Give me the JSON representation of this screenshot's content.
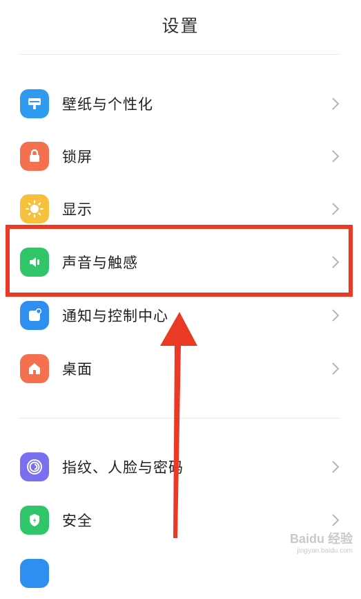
{
  "header": {
    "title": "设置"
  },
  "sections": [
    {
      "items": [
        {
          "label": "壁纸与个性化",
          "icon": "wallpaper-icon",
          "color": "#2e9bf0"
        },
        {
          "label": "锁屏",
          "icon": "lock-icon",
          "color": "#f4704e"
        },
        {
          "label": "显示",
          "icon": "brightness-icon",
          "color": "#f7c03c"
        },
        {
          "label": "声音与触感",
          "icon": "speaker-icon",
          "color": "#31c56a"
        },
        {
          "label": "通知与控制中心",
          "icon": "notification-icon",
          "color": "#2e8ff0"
        },
        {
          "label": "桌面",
          "icon": "home-icon",
          "color": "#f4704e"
        }
      ]
    },
    {
      "items": [
        {
          "label": "指纹、人脸与密码",
          "icon": "fingerprint-icon",
          "color": "#7a6ff0"
        },
        {
          "label": "安全",
          "icon": "shield-icon",
          "color": "#31c56a"
        }
      ]
    }
  ],
  "annotation": {
    "highlight_color": "#ea3a25",
    "arrow_color": "#ea3a25"
  },
  "watermark": {
    "text": "Baidu 经验",
    "sub": "jingyan.baidu.com"
  }
}
